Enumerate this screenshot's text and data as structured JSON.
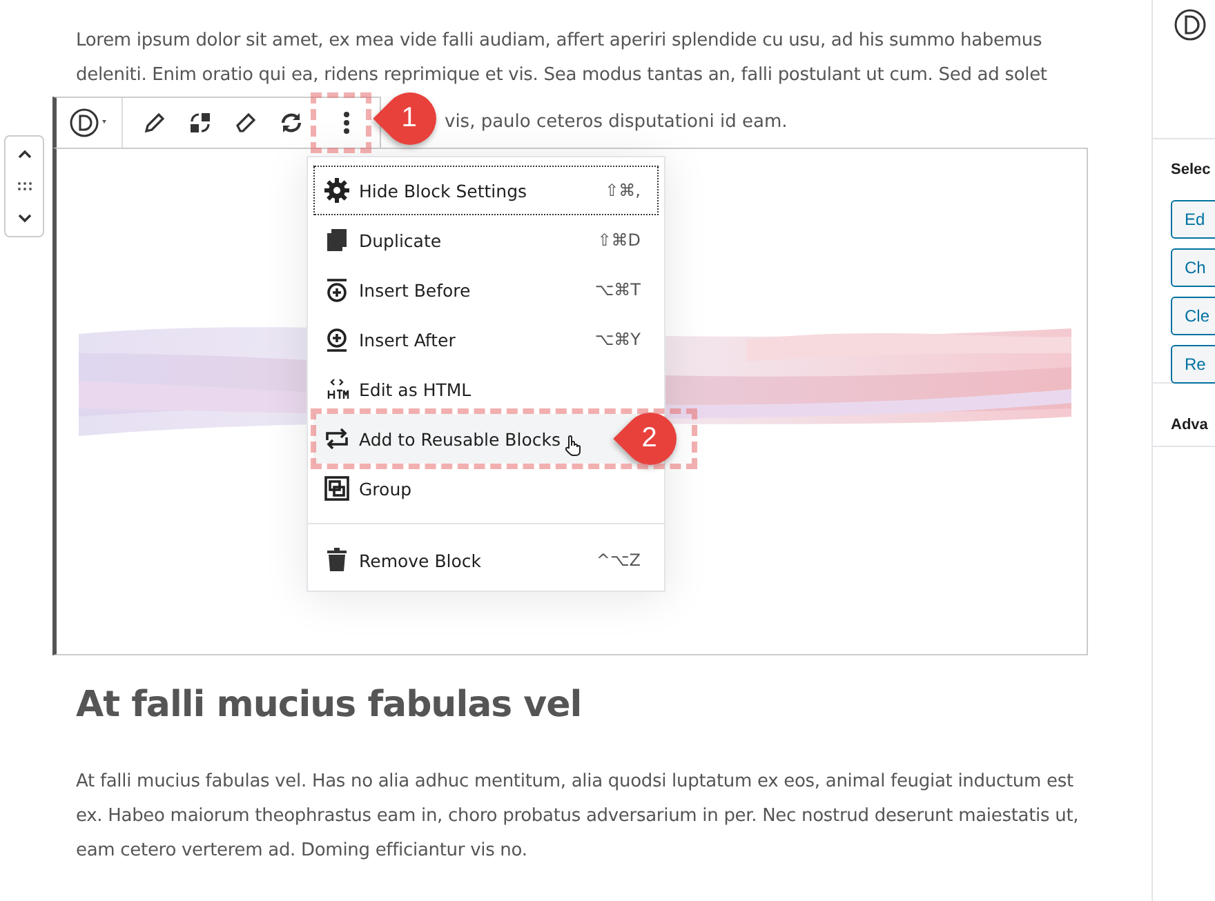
{
  "intro": {
    "text": "Lorem ipsum dolor sit amet, ex mea vide falli audiam, affert aperiri splendide cu usu, ad his summo habemus deleniti. Enim oratio qui ea, ridens reprimique et vis. Sea modus tantas an, falli postulant ut cum. Sed ad solet",
    "tail": "vis, paulo ceteros disputationi id eam."
  },
  "toolbar": {
    "buttons": [
      {
        "kind": "logo"
      },
      {
        "kind": "pencil"
      },
      {
        "kind": "swap"
      },
      {
        "kind": "eraser"
      },
      {
        "kind": "refresh"
      },
      {
        "kind": "more"
      }
    ]
  },
  "menu": {
    "groups": [
      [
        {
          "kind": "gear",
          "label": "Hide Block Settings",
          "shortcut": "⇧⌘,",
          "focused": true,
          "hovered": false
        },
        {
          "kind": "copy",
          "label": "Duplicate",
          "shortcut": "⇧⌘D",
          "focused": false,
          "hovered": false
        },
        {
          "kind": "before",
          "label": "Insert Before",
          "shortcut": "⌥⌘T",
          "focused": false,
          "hovered": false
        },
        {
          "kind": "after",
          "label": "Insert After",
          "shortcut": "⌥⌘Y",
          "focused": false,
          "hovered": false
        },
        {
          "kind": "html",
          "label": "Edit as HTML",
          "focused": false,
          "hovered": false
        },
        {
          "kind": "reuse",
          "label": "Add to Reusable Blocks",
          "focused": false,
          "hovered": true
        },
        {
          "kind": "group",
          "label": "Group",
          "focused": false,
          "hovered": false
        }
      ],
      [
        {
          "kind": "trash",
          "label": "Remove Block",
          "shortcut": "^⌥Z",
          "focused": false,
          "hovered": false
        }
      ]
    ]
  },
  "callouts": [
    {
      "label": "1"
    },
    {
      "label": "2"
    }
  ],
  "heading": "At falli mucius fabulas vel",
  "body": "At falli mucius fabulas vel. Has no alia adhuc mentitum, alia quodsi luptatum ex eos, animal feugiat inductum est ex. Habeo maiorum theophrastus eam in, choro probatus adversarium in per. Nec nostrud deserunt maiestatis ut, eam cetero verterem ad. Doming efficiantur vis no.",
  "sidebar": {
    "section": "Selec",
    "buttons": [
      "Ed",
      "Ch",
      "Cle",
      "Re"
    ],
    "advanced": "Adva"
  }
}
